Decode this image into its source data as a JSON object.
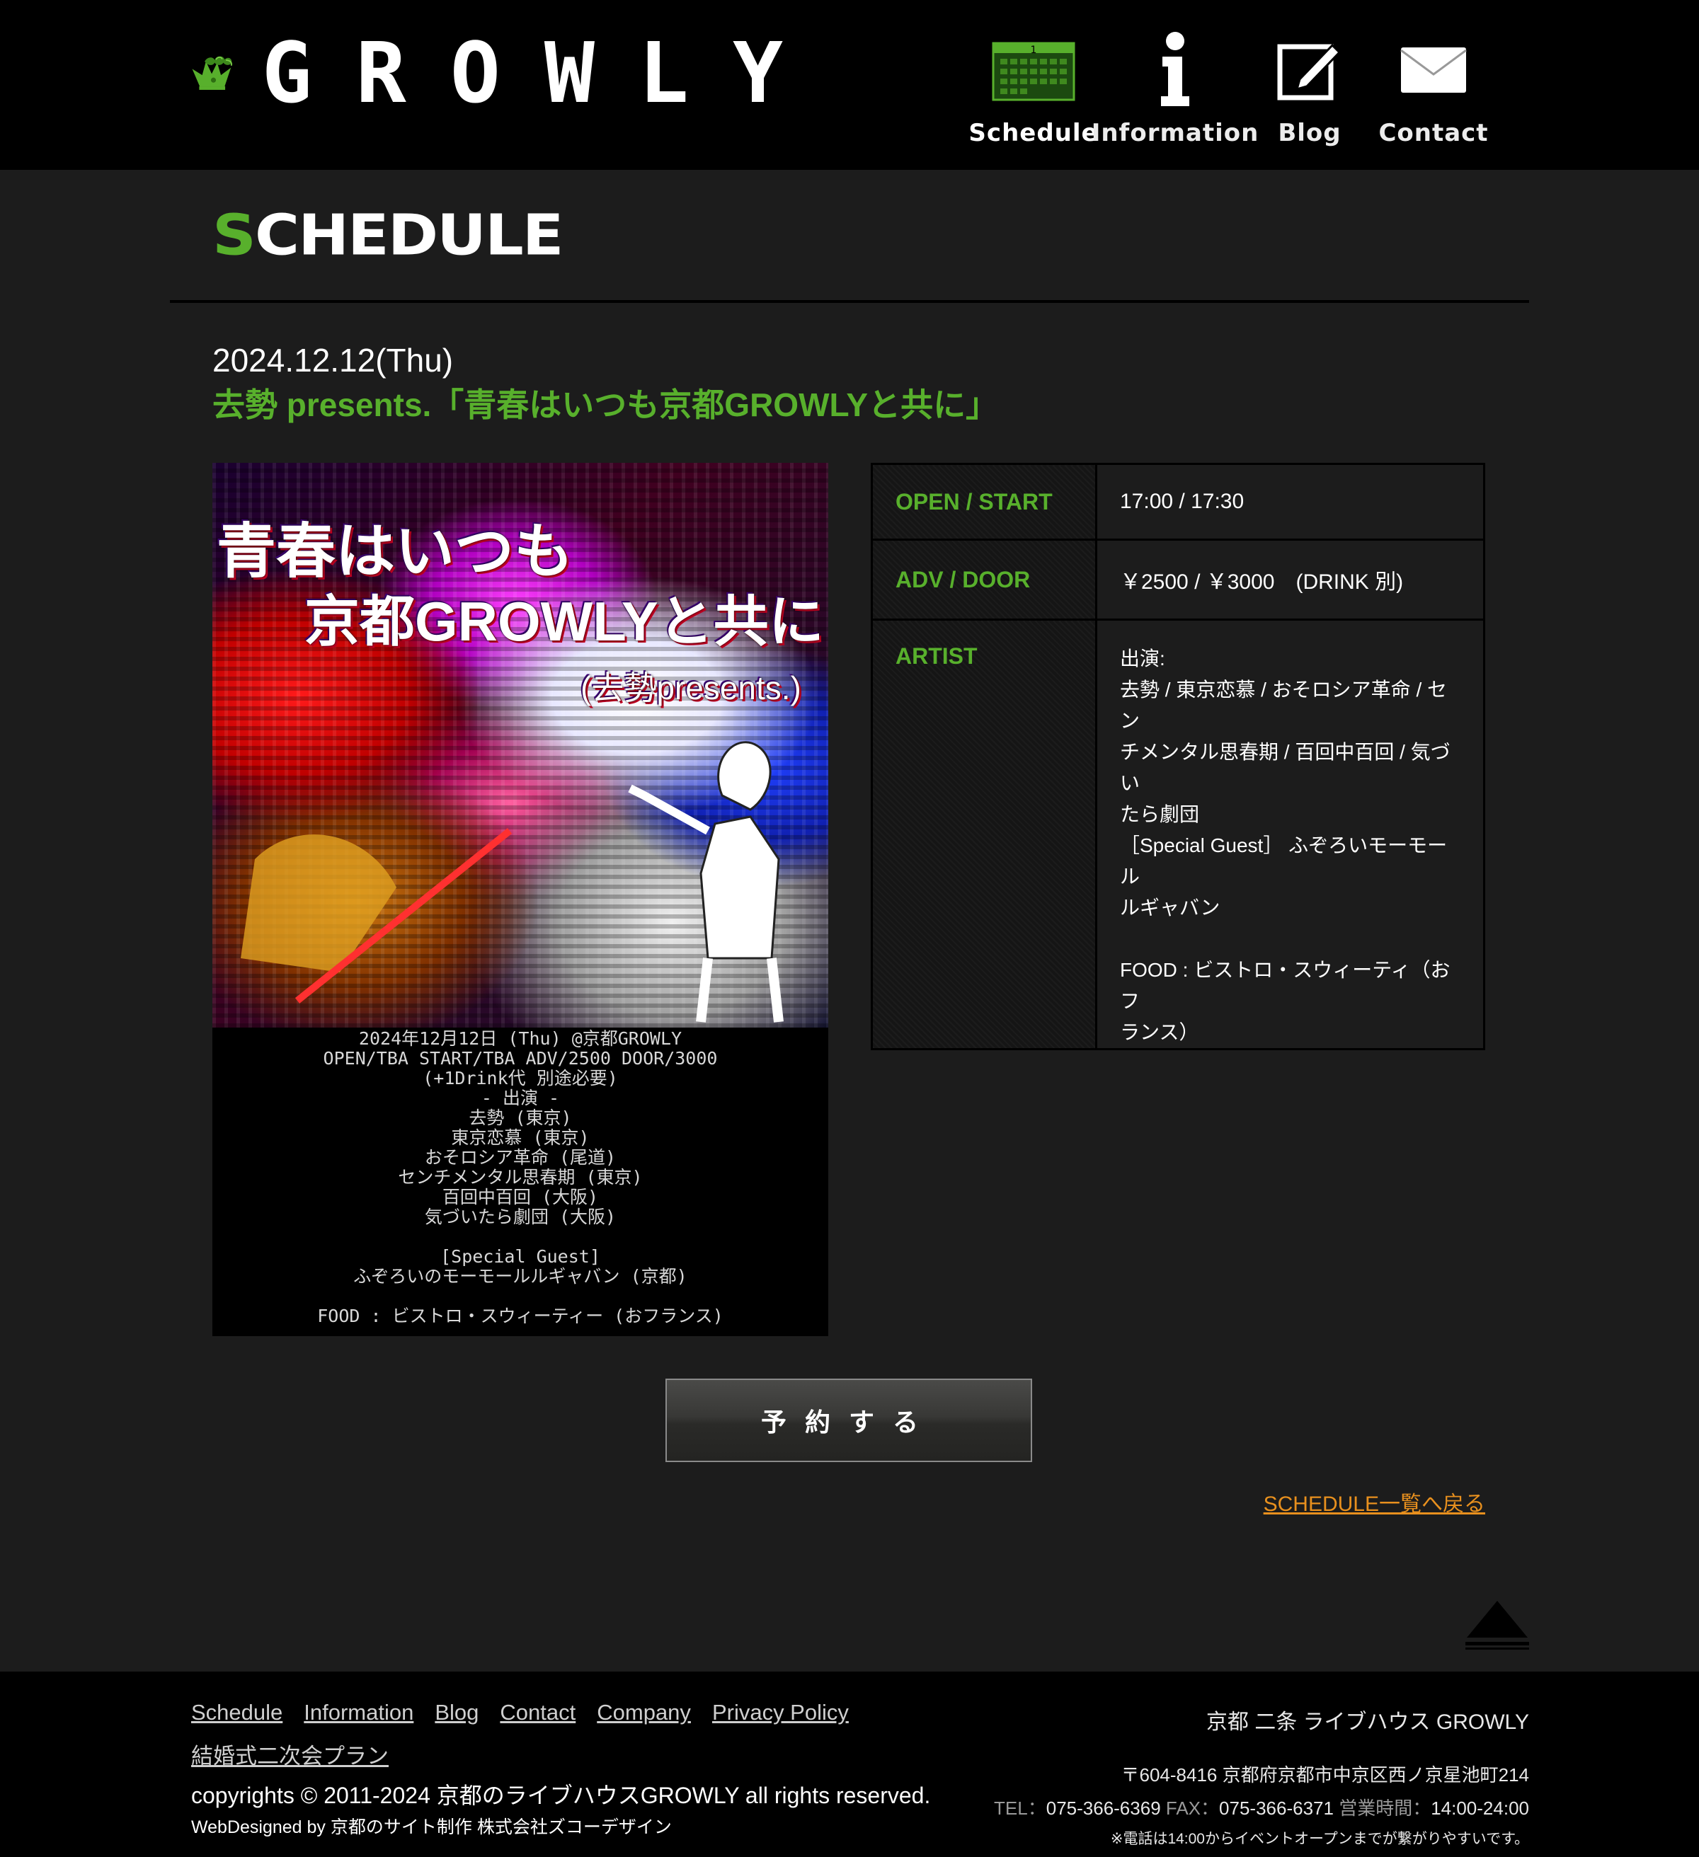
{
  "header": {
    "logo_text": "GROWLY",
    "nav": [
      {
        "label": "Schedule",
        "icon": "calendar-icon"
      },
      {
        "label": "Information",
        "icon": "info-icon"
      },
      {
        "label": "Blog",
        "icon": "pencil-note-icon"
      },
      {
        "label": "Contact",
        "icon": "envelope-icon"
      }
    ]
  },
  "page": {
    "heading_first": "S",
    "heading_rest": "CHEDULE"
  },
  "event": {
    "date": "2024.12.12(Thu)",
    "title": "去勢 presents.「青春はいつも京都GROWLYと共に」",
    "poster": {
      "title_line1": "青春はいつも",
      "title_line2": "京都GROWLYと共に",
      "title_line3": "(去勢presents.)",
      "info_lines": [
        "2024年12月12日 (Thu) @京都GROWLY",
        "OPEN/TBA START/TBA ADV/2500 DOOR/3000",
        "(+1Drink代 別途必要)",
        "- 出演 -",
        "去勢 (東京)",
        "東京恋慕 (東京)",
        "おそロシア革命 (尾道)",
        "センチメンタル思春期 (東京)",
        "百回中百回 (大阪)",
        "気づいたら劇団 (大阪)",
        "",
        "[Special Guest]",
        "ふぞろいのモーモールルギャバン (京都)",
        "",
        "FOOD : ビストロ・スウィーティー (おフランス)"
      ]
    },
    "table": {
      "open_label": "OPEN / START",
      "open_value": "17:00 / 17:30",
      "price_label": "ADV / DOOR",
      "price_value": "￥2500 / ￥3000　(DRINK 別)",
      "artist_label": "ARTIST",
      "artist_lines": [
        "出演:",
        "去勢 / 東京恋慕 / おそロシア革命 / セン",
        "チメンタル思春期 / 百回中百回 / 気づい",
        "たら劇団",
        "［Special Guest］ ふぞろいモーモール",
        "ルギャバン",
        "",
        "FOOD : ビストロ・スウィーティ（おフ",
        "ランス）"
      ]
    },
    "reserve_label": "予約する",
    "back_link": "SCHEDULE一覧へ戻る"
  },
  "footer": {
    "links": [
      "Schedule",
      "Information",
      "Blog",
      "Contact",
      "Company",
      "Privacy Policy",
      "結婚式二次会プラン"
    ],
    "copyright": "copyrights © 2011-2024 京都のライブハウスGROWLY all rights reserved.",
    "webdesign": "WebDesigned by 京都のサイト制作 株式会社ズコーデザイン",
    "venue_name": "京都 二条 ライブハウス GROWLY",
    "address": "〒604-8416 京都府京都市中京区西ノ京星池町214",
    "tel_label": "TEL：",
    "tel": "075-366-6369",
    "fax_label": "FAX：",
    "fax": "075-366-6371",
    "hours_label": "営業時間：",
    "hours": "14:00-24:00",
    "note": "※電話は14:00からイベントオープンまでが繋がりやすいです。"
  },
  "colors": {
    "accent_green": "#58b02c",
    "link_orange": "#e8901e",
    "background": "#1c1c1c",
    "header_bg": "#000000"
  }
}
